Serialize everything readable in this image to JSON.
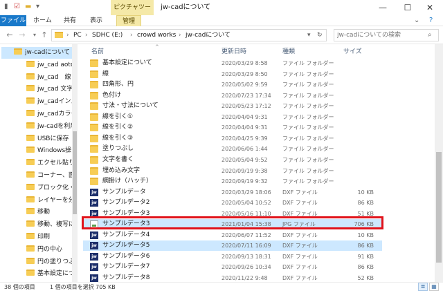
{
  "titlebar": {
    "context_tab": "ピクチャツール",
    "title": "jw-cadについて",
    "minimize": "—",
    "maximize": "☐",
    "close": "✕"
  },
  "ribbon": {
    "tabs": [
      "ファイル",
      "ホーム",
      "共有",
      "表示",
      "管理"
    ],
    "expand_icon": "⌄",
    "help_icon": "?"
  },
  "address": {
    "crumbs": [
      "PC",
      "SDHC (E:)",
      "crowd works",
      "jw-cadについて"
    ],
    "search_placeholder": "jw-cadについての検索"
  },
  "nav_items": [
    {
      "label": "jw-cadについて",
      "selected": true
    },
    {
      "label": "jw_cad aoto"
    },
    {
      "label": "jw_cad　線"
    },
    {
      "label": "jw_cad 文字"
    },
    {
      "label": "jw_cadインス"
    },
    {
      "label": "jw_cadカラー"
    },
    {
      "label": "jw-cadを利用"
    },
    {
      "label": "USBに保存"
    },
    {
      "label": "Windows操"
    },
    {
      "label": "エクセル貼り付"
    },
    {
      "label": "コーナー、面取"
    },
    {
      "label": "ブロック化・非"
    },
    {
      "label": "レイヤーを分け"
    },
    {
      "label": "移動"
    },
    {
      "label": "移動、複写に"
    },
    {
      "label": "印刷"
    },
    {
      "label": "円の中心"
    },
    {
      "label": "円の塗りつぶ"
    },
    {
      "label": "基本設定につ"
    }
  ],
  "columns": {
    "name": "名前",
    "date": "更新日時",
    "type": "種類",
    "size": "サイズ"
  },
  "files": [
    {
      "icon": "folder",
      "name": "基本設定について",
      "date": "2020/03/29 8:58",
      "type": "ファイル フォルダー",
      "size": ""
    },
    {
      "icon": "folder",
      "name": "線",
      "date": "2020/03/29 8:50",
      "type": "ファイル フォルダー",
      "size": ""
    },
    {
      "icon": "folder",
      "name": "四角形、円",
      "date": "2020/05/02 9:59",
      "type": "ファイル フォルダー",
      "size": ""
    },
    {
      "icon": "folder",
      "name": "色付け",
      "date": "2020/07/23 17:34",
      "type": "ファイル フォルダー",
      "size": ""
    },
    {
      "icon": "folder",
      "name": "寸法・寸法について",
      "date": "2020/05/23 17:12",
      "type": "ファイル フォルダー",
      "size": ""
    },
    {
      "icon": "folder",
      "name": "線を引く①",
      "date": "2020/04/04 9:31",
      "type": "ファイル フォルダー",
      "size": ""
    },
    {
      "icon": "folder",
      "name": "線を引く②",
      "date": "2020/04/04 9:31",
      "type": "ファイル フォルダー",
      "size": ""
    },
    {
      "icon": "folder",
      "name": "線を引く③",
      "date": "2020/04/25 9:39",
      "type": "ファイル フォルダー",
      "size": ""
    },
    {
      "icon": "folder",
      "name": "塗りつぶし",
      "date": "2020/06/06 1:44",
      "type": "ファイル フォルダー",
      "size": ""
    },
    {
      "icon": "folder",
      "name": "文字を書く",
      "date": "2020/05/04 9:52",
      "type": "ファイル フォルダー",
      "size": ""
    },
    {
      "icon": "folder",
      "name": "埋め込み文字",
      "date": "2020/09/19 9:38",
      "type": "ファイル フォルダー",
      "size": ""
    },
    {
      "icon": "folder",
      "name": "網掛け（ハッチ）",
      "date": "2020/09/19 9:32",
      "type": "ファイル フォルダー",
      "size": ""
    },
    {
      "icon": "jw",
      "name": "サンプルデータ",
      "date": "2020/03/29 18:06",
      "type": "DXF ファイル",
      "size": "10 KB"
    },
    {
      "icon": "jw",
      "name": "サンプルデータ2",
      "date": "2020/05/04 10:52",
      "type": "DXF ファイル",
      "size": "86 KB"
    },
    {
      "icon": "jw",
      "name": "サンプルデータ3",
      "date": "2020/05/16 11:10",
      "type": "DXF ファイル",
      "size": "51 KB"
    },
    {
      "icon": "jpg",
      "name": "サンプルデータ3",
      "date": "2021/01/04 15:38",
      "type": "JPG ファイル",
      "size": "706 KB",
      "highlight": true
    },
    {
      "icon": "jw",
      "name": "サンプルデータ4",
      "date": "2020/06/07 11:52",
      "type": "DXF ファイル",
      "size": "10 KB"
    },
    {
      "icon": "jw",
      "name": "サンプルデータ5",
      "date": "2020/07/11 16:09",
      "type": "DXF ファイル",
      "size": "86 KB",
      "hover": true
    },
    {
      "icon": "jw",
      "name": "サンプルデータ6",
      "date": "2020/09/13 18:31",
      "type": "DXF ファイル",
      "size": "91 KB"
    },
    {
      "icon": "jw",
      "name": "サンプルデータ7",
      "date": "2020/09/26 10:34",
      "type": "DXF ファイル",
      "size": "86 KB"
    },
    {
      "icon": "jw",
      "name": "サンプルデータ8",
      "date": "2020/11/22 9:48",
      "type": "DXF ファイル",
      "size": "52 KB"
    }
  ],
  "status": {
    "count": "38 個の項目",
    "selection": "1 個の項目を選択  705 KB"
  },
  "colors": {
    "accent": "#1979ca",
    "highlight_box": "#e0131b",
    "selected_row": "#cde8ff"
  }
}
